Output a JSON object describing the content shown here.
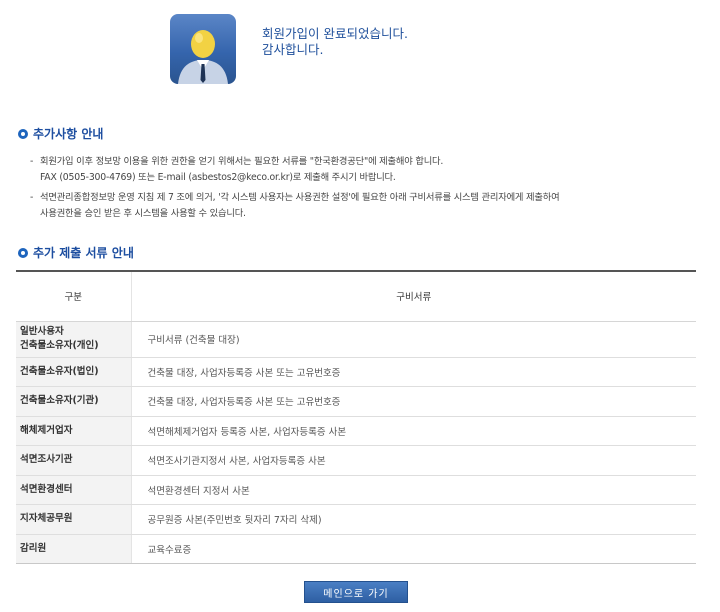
{
  "completion": {
    "line1": "회원가입이 완료되었습니다.",
    "line2": "감사합니다.",
    "icon": "user-avatar-icon"
  },
  "additional_info": {
    "title": "추가사항 안내",
    "items": [
      {
        "line1": "회원가입 이후 정보망 이용을 위한 권한을 얻기 위해서는 필요한 서류를 \"한국환경공단\"에 제출해야 합니다.",
        "line2": "FAX (0505-300-4769) 또는 E-mail (asbestos2@keco.or.kr)로 제출해 주시기 바랍니다."
      },
      {
        "line1": "석면관리종합정보망 운영 지침 제 7 조에 의거, '각 시스템 사용자는 사용권한 설정'에 필요한 아래 구비서류를 시스템 관리자에게 제출하여",
        "line2": "사용권한을 승인 받은 후 시스템을 사용할 수 있습니다."
      }
    ]
  },
  "documents": {
    "title": "추가 제출 서류 안내",
    "headers": [
      "구분",
      "구비서류"
    ],
    "rows": [
      {
        "type_line1": "일반사용자",
        "type_line2": "건축물소유자(개인)",
        "docs": "구비서류 (건축물 대장)"
      },
      {
        "type_line1": "건축물소유자(법인)",
        "type_line2": "",
        "docs": "건축물 대장, 사업자등록증 사본 또는 고유번호증"
      },
      {
        "type_line1": "건축물소유자(기관)",
        "type_line2": "",
        "docs": "건축물 대장, 사업자등록증 사본 또는 고유번호증"
      },
      {
        "type_line1": "해체제거업자",
        "type_line2": "",
        "docs": "석면해체제거업자 등록증 사본, 사업자등록증 사본"
      },
      {
        "type_line1": "석면조사기관",
        "type_line2": "",
        "docs": "석면조사기관지정서 사본, 사업자등록증 사본"
      },
      {
        "type_line1": "석면환경센터",
        "type_line2": "",
        "docs": "석면환경센터 지정서 사본"
      },
      {
        "type_line1": "지자체공무원",
        "type_line2": "",
        "docs": "공무원증 사본(주민번호 뒷자리 7자리 삭제)"
      },
      {
        "type_line1": "감리원",
        "type_line2": "",
        "docs": "교육수료증"
      }
    ]
  },
  "main_button": {
    "label": "메인으로 가기"
  }
}
